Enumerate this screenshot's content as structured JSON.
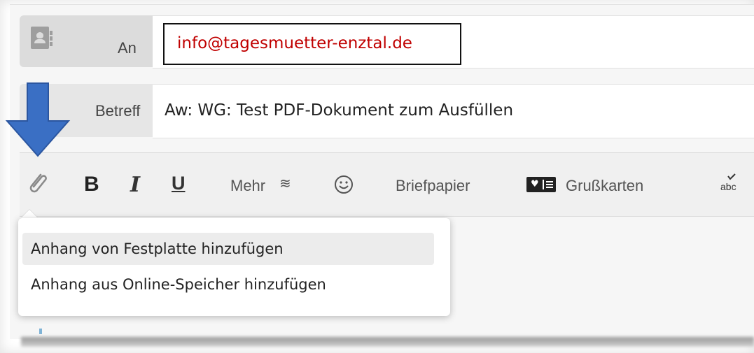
{
  "compose": {
    "to_label": "An",
    "to_value": "info@tagesmuetter-enztal.de",
    "subject_label": "Betreff",
    "subject_value": "Aw: WG: Test PDF-Dokument zum Ausfüllen"
  },
  "toolbar": {
    "attach_icon": "paperclip-icon",
    "bold": "B",
    "italic": "I",
    "underline": "U",
    "more_label": "Mehr",
    "more_icon": "≋",
    "emoji_icon": "smiley-icon",
    "stationery_label": "Briefpapier",
    "greeting_cards_label": "Grußkarten",
    "spellcheck_icon": "spellcheck-icon"
  },
  "attach_menu": {
    "items": [
      {
        "label": "Anhang von Festplatte hinzufügen",
        "highlighted": true
      },
      {
        "label": "Anhang aus Online-Speicher hinzufügen",
        "highlighted": false
      }
    ]
  },
  "annotation": {
    "arrow_color": "#3a6fc4"
  },
  "colors": {
    "email_text": "#c00000",
    "toolbar_bg": "#f0f0f0"
  }
}
